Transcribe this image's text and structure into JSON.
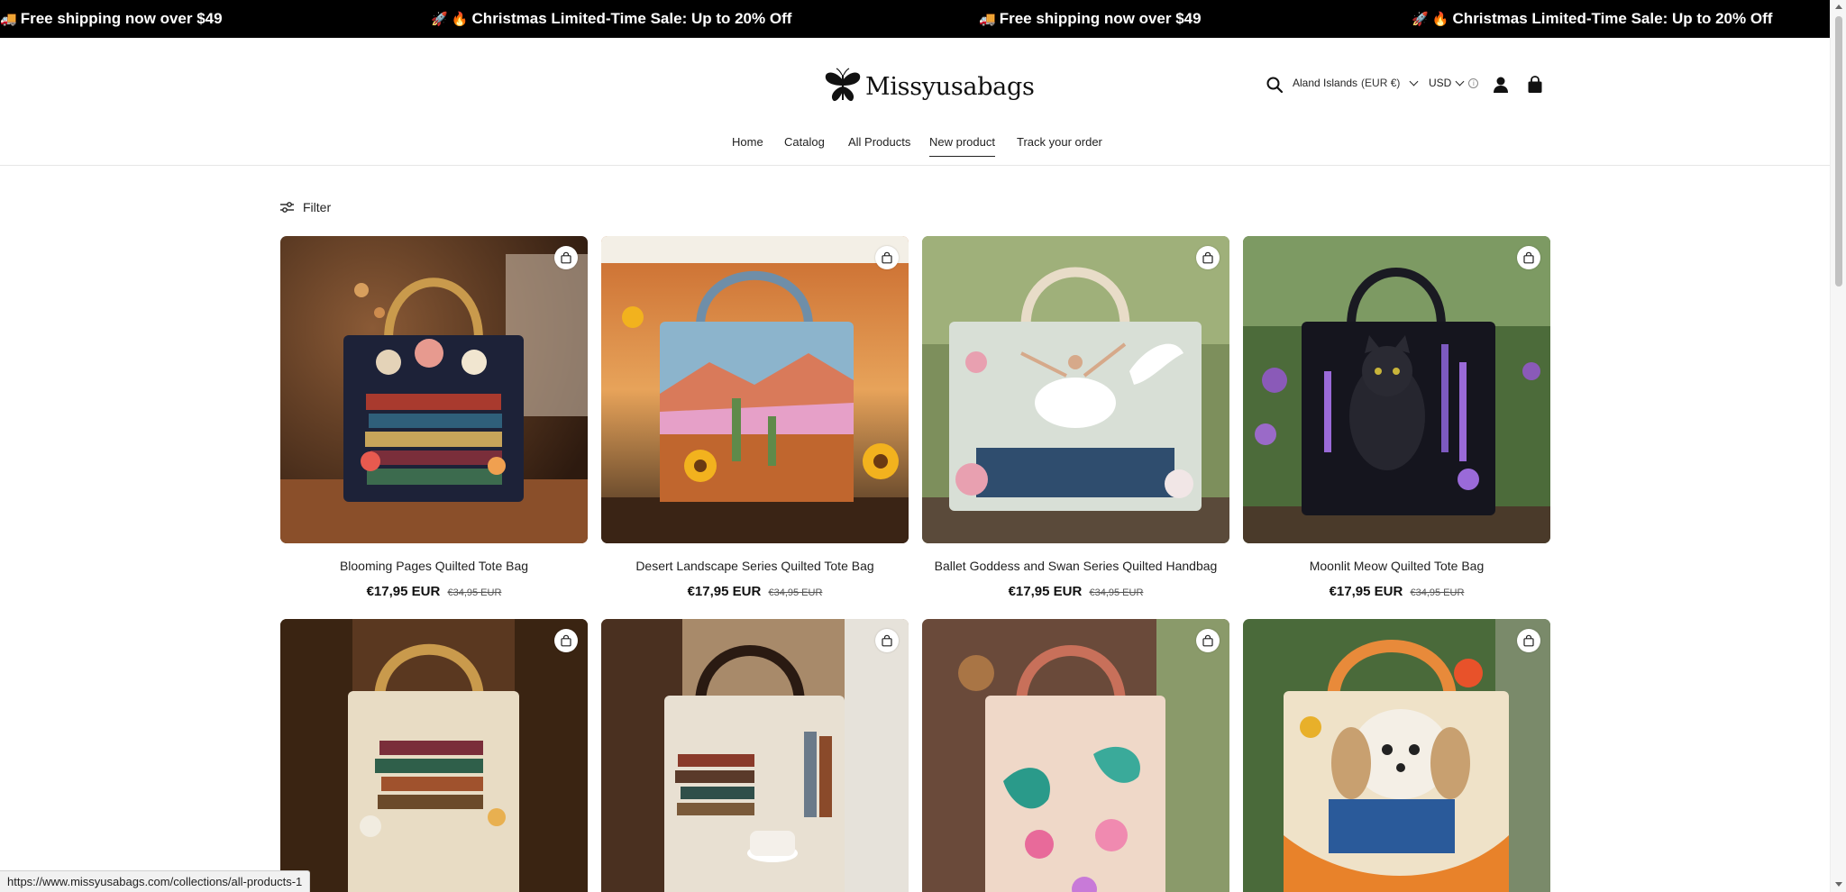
{
  "announcement": {
    "items": [
      {
        "emoji": "🚚",
        "text": "Free shipping now over $49"
      },
      {
        "emoji": "🚀 🔥",
        "text": "Christmas Limited-Time Sale: Up to 20% Off"
      },
      {
        "emoji": "🚚",
        "text": "Free shipping now over $49"
      },
      {
        "emoji": "🚀 🔥",
        "text": "Christmas Limited-Time Sale: Up to 20% Off"
      }
    ]
  },
  "header": {
    "logo_text": "Missyusabags",
    "country": "Aland Islands",
    "country_currency": "(EUR €)",
    "currency": "USD"
  },
  "nav": {
    "items": [
      {
        "label": "Home"
      },
      {
        "label": "Catalog"
      },
      {
        "label": "All Products"
      },
      {
        "label": "New product"
      },
      {
        "label": "Track your order"
      }
    ],
    "active": "New product"
  },
  "filter": {
    "label": "Filter"
  },
  "products": [
    {
      "title": "Blooming Pages Quilted Tote Bag",
      "price": "€17,95 EUR",
      "compare_price": "€34,95 EUR"
    },
    {
      "title": "Desert Landscape Series Quilted Tote Bag",
      "price": "€17,95 EUR",
      "compare_price": "€34,95 EUR"
    },
    {
      "title": "Ballet Goddess and Swan Series Quilted Handbag",
      "price": "€17,95 EUR",
      "compare_price": "€34,95 EUR"
    },
    {
      "title": "Moonlit Meow Quilted Tote Bag",
      "price": "€17,95 EUR",
      "compare_price": "€34,95 EUR"
    },
    {
      "title": "",
      "price": "",
      "compare_price": ""
    },
    {
      "title": "",
      "price": "",
      "compare_price": ""
    },
    {
      "title": "",
      "price": "",
      "compare_price": ""
    },
    {
      "title": "",
      "price": "",
      "compare_price": ""
    }
  ],
  "status_bar": {
    "url": "https://www.missyusabags.com/collections/all-products-1"
  },
  "colors": {
    "announcement_bg": "#000000",
    "text": "#121212"
  }
}
